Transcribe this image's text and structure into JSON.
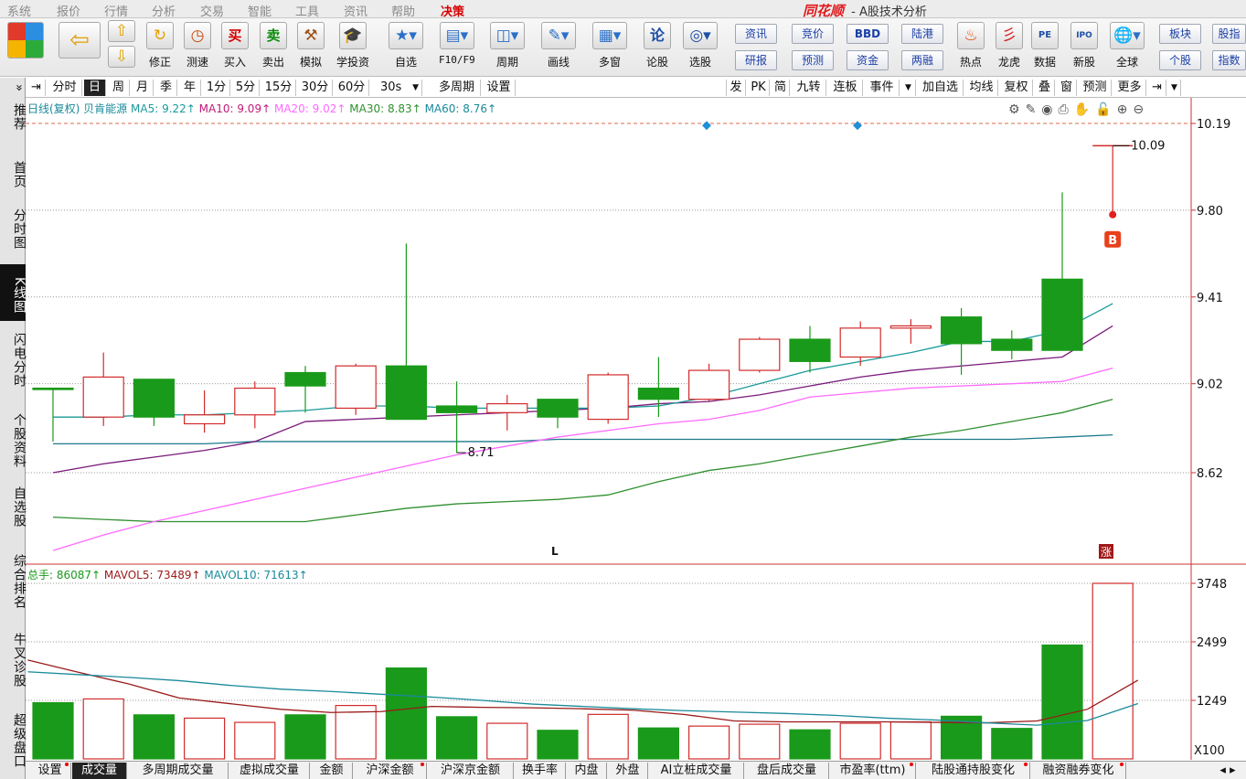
{
  "menu": {
    "items": [
      "系统",
      "报价",
      "行情",
      "分析",
      "交易",
      "智能",
      "工具",
      "资讯",
      "帮助",
      "决策"
    ],
    "highlight": "决策",
    "brand": "同花顺",
    "title": " - A股技术分析"
  },
  "toolbar": {
    "buttons": [
      {
        "label": "",
        "icon": "layout-grid-icon"
      },
      {
        "label": "",
        "icon": "back-arrow-icon"
      },
      {
        "label": "修正",
        "icon": "up-down-icon"
      },
      {
        "label": "测速",
        "icon": "clock-icon"
      },
      {
        "label": "买入",
        "icon": "buy-icon",
        "glyph": "买"
      },
      {
        "label": "卖出",
        "icon": "sell-icon",
        "glyph": "卖"
      },
      {
        "label": "模拟",
        "icon": "gavel-icon"
      },
      {
        "label": "学投资",
        "icon": "graduation-cap-icon"
      },
      {
        "label": "自选",
        "icon": "star-folder-icon"
      },
      {
        "label": "F10/F9",
        "icon": "f10-icon"
      },
      {
        "label": "周期",
        "icon": "calendar-icon"
      },
      {
        "label": "画线",
        "icon": "pen-icon"
      },
      {
        "label": "多窗",
        "icon": "windows-icon"
      },
      {
        "label": "论股",
        "icon": "lun-icon",
        "glyph": "论"
      },
      {
        "label": "选股",
        "icon": "chart-search-icon"
      }
    ],
    "small_buttons": [
      [
        "资讯",
        "研报"
      ],
      [
        "竞价",
        "预测"
      ],
      [
        "BBD",
        "资金"
      ],
      [
        "陆港",
        "两融"
      ]
    ],
    "right_buttons": [
      {
        "label": "热点",
        "icon": "hot-icon"
      },
      {
        "label": "龙虎",
        "icon": "dragon-icon"
      },
      {
        "label": "数据",
        "icon": "pe-icon",
        "glyph": "PE"
      },
      {
        "label": "新股",
        "icon": "ipo-icon",
        "glyph": "IPO"
      },
      {
        "label": "全球",
        "icon": "globe-icon"
      }
    ],
    "far_right": [
      [
        "板块",
        "个股"
      ],
      [
        "股指",
        "指数"
      ]
    ]
  },
  "sidebar": {
    "items": [
      "推荐",
      "首页",
      "分时图",
      "K线图",
      "闪电分时",
      "个股资料",
      "自选股",
      "综合排名",
      "牛叉诊股",
      "超级盘口"
    ],
    "active": "K线图"
  },
  "period_bar": {
    "items": [
      "分时",
      "日",
      "周",
      "月",
      "季",
      "年",
      "1分",
      "5分",
      "15分",
      "30分",
      "60分",
      "30s",
      "多周期",
      "设置"
    ],
    "selected": "日",
    "right_items": [
      "发",
      "PK",
      "简",
      "九转",
      "连板",
      "事件",
      "加自选",
      "均线",
      "复权",
      "叠",
      "窗",
      "预测",
      "更多"
    ]
  },
  "ma_legend": {
    "title": "日线(复权) 贝肯能源",
    "ma5": "MA5: 9.22↑",
    "ma10": "MA10: 9.09↑",
    "ma20": "MA20: 9.02↑",
    "ma30": "MA30: 8.83↑",
    "ma60": "MA60: 8.76↑"
  },
  "vol_legend": {
    "total": "总手: 86087↑",
    "mavol5": "MAVOL5: 73489↑",
    "mavol10": "MAVOL10: 71613↑"
  },
  "bottom_tabs": {
    "items": [
      "设置",
      "成交量",
      "多周期成交量",
      "虚拟成交量",
      "金额",
      "沪深金额",
      "沪深京金额",
      "换手率",
      "内盘",
      "外盘",
      "AI立桩成交量",
      "盘后成交量",
      "市盈率(ttm)",
      "陆股通持股变化",
      "融资融券变化"
    ],
    "selected": "成交量",
    "dotted": [
      "设置",
      "沪深金额",
      "市盈率(ttm)",
      "陆股通持股变化",
      "融资融券变化"
    ]
  },
  "colors": {
    "up": "#d22b2b",
    "down": "#1a9a1a",
    "ma5": "#1a9a9a",
    "ma10": "#7a1a7a",
    "ma20": "#ff6aff",
    "ma30": "#2f8f2f",
    "ma60": "#1a7a8a"
  },
  "chart_data": {
    "type": "candlestick",
    "price_axis": {
      "ticks": [
        "10.19",
        "9.80",
        "9.41",
        "9.02",
        "8.62"
      ],
      "range": [
        8.4,
        10.3
      ]
    },
    "volume_axis": {
      "ticks": [
        "3748",
        "2499",
        "1249"
      ],
      "unit": "X100",
      "range": [
        0,
        4000
      ]
    },
    "annotations": {
      "high_label": "10.09",
      "low_label": "8.71",
      "signal": "B",
      "zhang": "涨",
      "marker_L": "L"
    },
    "candles": [
      {
        "o": 9.0,
        "h": 9.0,
        "l": 8.76,
        "c": 9.0,
        "v": 1200
      },
      {
        "o": 8.87,
        "h": 9.16,
        "l": 8.83,
        "c": 9.05,
        "v": 1280
      },
      {
        "o": 9.04,
        "h": 9.04,
        "l": 8.83,
        "c": 8.87,
        "v": 940
      },
      {
        "o": 8.84,
        "h": 8.99,
        "l": 8.8,
        "c": 8.88,
        "v": 870
      },
      {
        "o": 8.88,
        "h": 9.03,
        "l": 8.82,
        "c": 9.0,
        "v": 780
      },
      {
        "o": 9.07,
        "h": 9.1,
        "l": 8.89,
        "c": 9.01,
        "v": 940
      },
      {
        "o": 8.91,
        "h": 9.11,
        "l": 8.88,
        "c": 9.1,
        "v": 1140
      },
      {
        "o": 9.1,
        "h": 9.65,
        "l": 8.88,
        "c": 8.86,
        "v": 1940
      },
      {
        "o": 8.92,
        "h": 9.03,
        "l": 8.71,
        "c": 8.89,
        "v": 900
      },
      {
        "o": 8.89,
        "h": 8.97,
        "l": 8.81,
        "c": 8.93,
        "v": 760
      },
      {
        "o": 8.95,
        "h": 8.95,
        "l": 8.82,
        "c": 8.87,
        "v": 610
      },
      {
        "o": 8.86,
        "h": 9.07,
        "l": 8.84,
        "c": 9.06,
        "v": 950
      },
      {
        "o": 9.0,
        "h": 9.14,
        "l": 8.87,
        "c": 8.95,
        "v": 660
      },
      {
        "o": 8.95,
        "h": 9.11,
        "l": 8.94,
        "c": 9.08,
        "v": 700
      },
      {
        "o": 9.08,
        "h": 9.23,
        "l": 9.07,
        "c": 9.22,
        "v": 740
      },
      {
        "o": 9.22,
        "h": 9.28,
        "l": 9.07,
        "c": 9.12,
        "v": 620
      },
      {
        "o": 9.14,
        "h": 9.3,
        "l": 9.1,
        "c": 9.27,
        "v": 760
      },
      {
        "o": 9.27,
        "h": 9.31,
        "l": 9.2,
        "c": 9.28,
        "v": 790
      },
      {
        "o": 9.32,
        "h": 9.36,
        "l": 9.06,
        "c": 9.2,
        "v": 910
      },
      {
        "o": 9.22,
        "h": 9.26,
        "l": 9.13,
        "c": 9.17,
        "v": 650
      },
      {
        "o": 9.49,
        "h": 9.88,
        "l": 9.17,
        "c": 9.17,
        "v": 2430
      },
      {
        "o": 10.09,
        "h": 10.09,
        "l": 10.09,
        "c": 10.09,
        "v": 3748
      }
    ],
    "ma5": [
      8.87,
      8.87,
      8.88,
      8.88,
      8.89,
      8.9,
      8.92,
      8.92,
      8.91,
      8.91,
      8.91,
      8.91,
      8.92,
      8.96,
      9.02,
      9.08,
      9.12,
      9.16,
      9.21,
      9.21,
      9.26,
      9.38
    ],
    "ma10": [
      8.62,
      8.66,
      8.69,
      8.72,
      8.76,
      8.85,
      8.86,
      8.87,
      8.88,
      8.89,
      8.9,
      8.91,
      8.93,
      8.94,
      8.97,
      9.01,
      9.05,
      9.08,
      9.1,
      9.12,
      9.14,
      9.28
    ],
    "ma20": [
      8.27,
      8.34,
      8.4,
      8.45,
      8.5,
      8.55,
      8.6,
      8.65,
      8.7,
      8.74,
      8.78,
      8.81,
      8.84,
      8.86,
      8.9,
      8.96,
      8.98,
      9.0,
      9.01,
      9.02,
      9.03,
      9.09
    ],
    "ma30": [
      8.42,
      8.41,
      8.4,
      8.4,
      8.4,
      8.4,
      8.43,
      8.46,
      8.48,
      8.49,
      8.5,
      8.52,
      8.58,
      8.63,
      8.66,
      8.7,
      8.74,
      8.78,
      8.81,
      8.85,
      8.89,
      8.95
    ],
    "ma60": [
      8.75,
      8.75,
      8.75,
      8.75,
      8.76,
      8.76,
      8.76,
      8.76,
      8.76,
      8.76,
      8.77,
      8.77,
      8.77,
      8.77,
      8.77,
      8.77,
      8.77,
      8.77,
      8.77,
      8.77,
      8.78,
      8.79
    ],
    "mavol5": [
      2110,
      1850,
      1600,
      1300,
      1180,
      1060,
      990,
      1010,
      1120,
      1100,
      1090,
      1070,
      1040,
      950,
      810,
      790,
      790,
      790,
      780,
      770,
      810,
      1060,
      1680
    ],
    "mavol10": [
      1860,
      1800,
      1740,
      1670,
      1570,
      1490,
      1440,
      1380,
      1320,
      1250,
      1170,
      1120,
      1070,
      1030,
      1000,
      970,
      930,
      870,
      830,
      770,
      720,
      820,
      1180
    ]
  }
}
